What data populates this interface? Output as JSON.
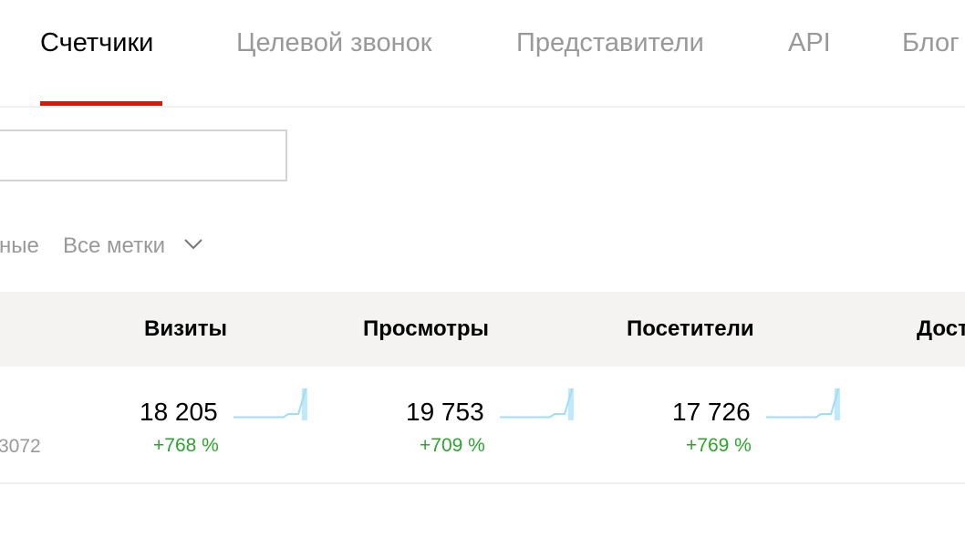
{
  "tabs": [
    {
      "label": "Счетчики",
      "active": true
    },
    {
      "label": "Целевой звонок",
      "active": false
    },
    {
      "label": "Представители",
      "active": false
    },
    {
      "label": "API",
      "active": false
    },
    {
      "label": "Блог",
      "active": false
    }
  ],
  "search": {
    "value": "",
    "placeholder": ""
  },
  "filters": {
    "partial_label": "ные",
    "tags_label": "Все метки"
  },
  "table": {
    "headers": [
      "Визиты",
      "Просмотры",
      "Посетители",
      "Дост"
    ],
    "row": {
      "id_partial": "3072",
      "metrics": [
        {
          "value": "18 205",
          "delta": "+768 %",
          "spark": [
            1,
            1,
            1,
            1,
            1,
            1,
            1,
            1,
            1,
            1,
            1,
            2,
            2,
            2,
            10
          ]
        },
        {
          "value": "19 753",
          "delta": "+709 %",
          "spark": [
            1,
            1,
            1,
            1,
            1,
            1,
            1,
            1,
            1,
            1,
            1,
            2,
            2,
            2,
            10
          ]
        },
        {
          "value": "17 726",
          "delta": "+769 %",
          "spark": [
            1,
            1,
            1,
            1,
            1,
            1,
            1,
            1,
            1,
            1,
            1,
            2,
            2,
            2,
            10
          ]
        }
      ]
    }
  },
  "colors": {
    "accent": "#e61400",
    "positive": "#2ea32e",
    "spark_line": "#9fdcf5",
    "spark_bar": "#bfe8fa",
    "header_bg": "#f4f3f1"
  }
}
